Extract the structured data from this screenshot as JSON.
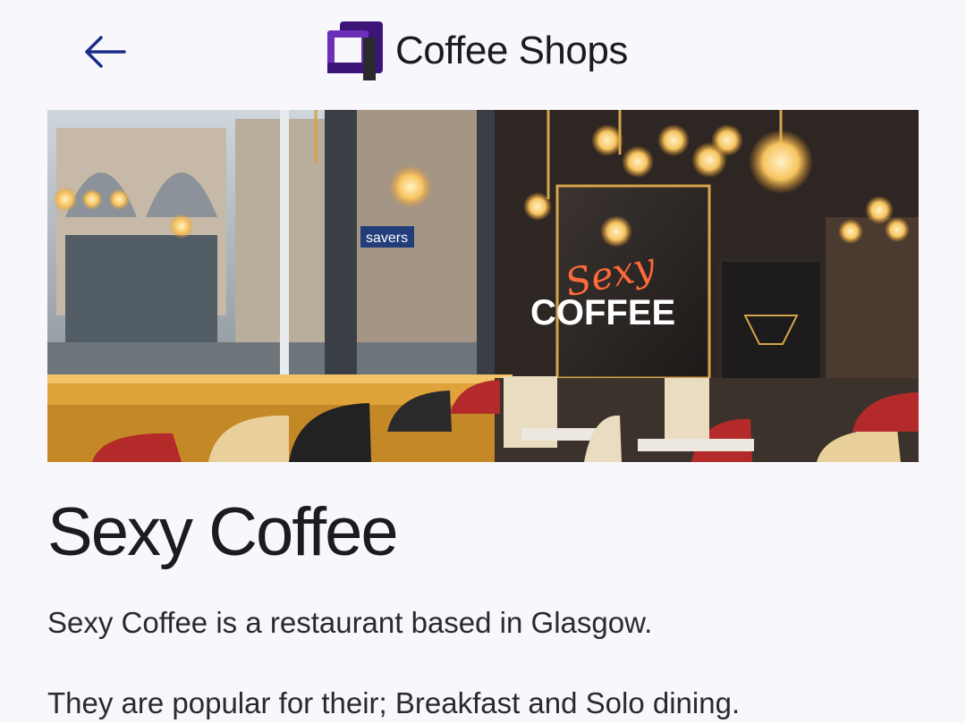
{
  "header": {
    "back_icon": "arrow-left-icon",
    "logo_icon": "coffee-shops-logo",
    "title": "Coffee Shops"
  },
  "hero": {
    "sign_script": "Sexy",
    "sign_main": "COFFEE",
    "window_sign": "savers"
  },
  "shop": {
    "name": "Sexy Coffee",
    "description_1": "Sexy Coffee is a restaurant based in Glasgow.",
    "description_2": "They are popular for their; Breakfast and Solo dining."
  },
  "colors": {
    "background": "#f8f7fc",
    "text": "#1c1b20",
    "logo_primary": "#3d1478",
    "logo_accent": "#6b2fb8",
    "back_arrow": "#1a2c8a"
  }
}
